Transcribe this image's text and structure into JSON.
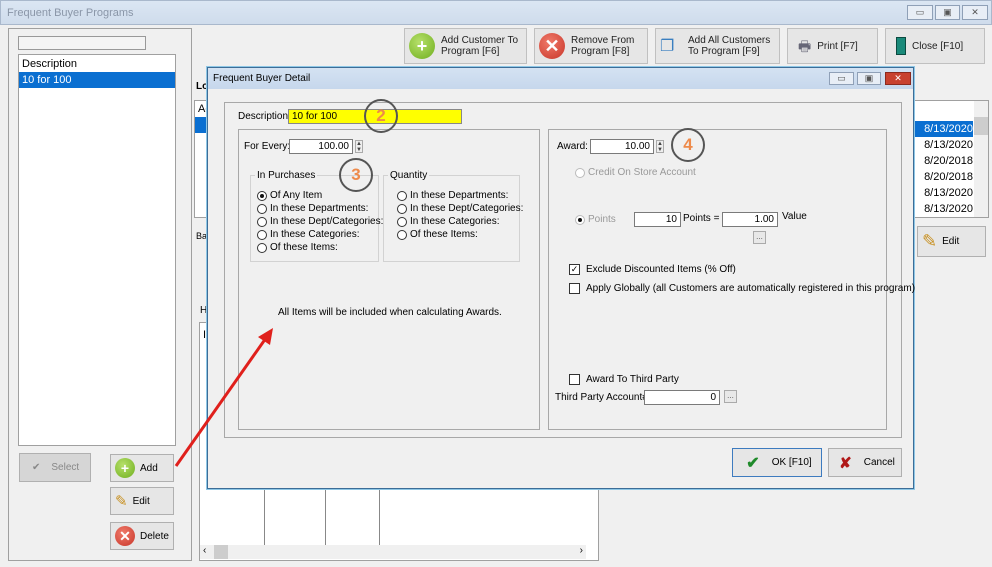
{
  "window": {
    "title": "Frequent Buyer Programs",
    "controls": {
      "minimize": "▭",
      "maximize": "▣",
      "close": "✕"
    }
  },
  "toolbar": {
    "add_customer": "Add Customer To\nProgram [F6]",
    "remove": "Remove From\nProgram [F8]",
    "add_all": "Add All Customers\nTo Program [F9]",
    "print": "Print [F7]",
    "close": "Close [F10]"
  },
  "programs": {
    "header": "Description",
    "items": [
      "10 for 100"
    ]
  },
  "left_buttons": {
    "select": "Select",
    "add": "Add",
    "edit": "Edit",
    "delete": "Delete"
  },
  "background": {
    "lo": "Lo",
    "ac": "Ac",
    "bal": "Bal",
    "h": "H",
    "i": "I"
  },
  "dates": [
    "8/13/2020",
    "8/13/2020",
    "8/20/2018",
    "8/20/2018",
    "8/13/2020",
    "8/13/2020"
  ],
  "right_edit": "Edit",
  "dialog": {
    "title": "Frequent Buyer Detail",
    "description_label": "Description:",
    "description_value": "10 for 100",
    "for_every_label": "For Every:",
    "for_every_value": "100.00",
    "in_purchases": {
      "label": "In Purchases",
      "options": [
        "Of Any Item",
        "In these Departments:",
        "In these Dept/Categories:",
        "In these Categories:",
        "Of these Items:"
      ],
      "selected": 0
    },
    "quantity": {
      "label": "Quantity",
      "options": [
        "In these Departments:",
        "In these Dept/Categories:",
        "In these Categories:",
        "Of these Items:"
      ]
    },
    "info_text": "All Items will be included when calculating Awards.",
    "award_label": "Award:",
    "award_value": "10.00",
    "credit_label": "Credit On Store Account",
    "points_label": "Points",
    "points_value": "10",
    "points_eq": "Points =",
    "value_value": "1.00",
    "value_label": "Value",
    "ellipsis": "...",
    "exclude_label": "Exclude Discounted Items (% Off)",
    "exclude_checked": true,
    "apply_label": "Apply Globally (all Customers are automatically registered in this program)",
    "apply_checked": false,
    "third_party_label": "Award To Third Party",
    "third_party_checked": false,
    "third_party_acct_label": "Third Party Account#:",
    "third_party_acct_value": "0",
    "ok": "OK [F10]",
    "cancel": "Cancel"
  },
  "annotations": [
    "2",
    "3",
    "4"
  ],
  "colors": {
    "highlight": "#ffff00",
    "selection": "#0a6fd1",
    "annotation": "#ee8a4a",
    "arrow": "#e0201c"
  }
}
